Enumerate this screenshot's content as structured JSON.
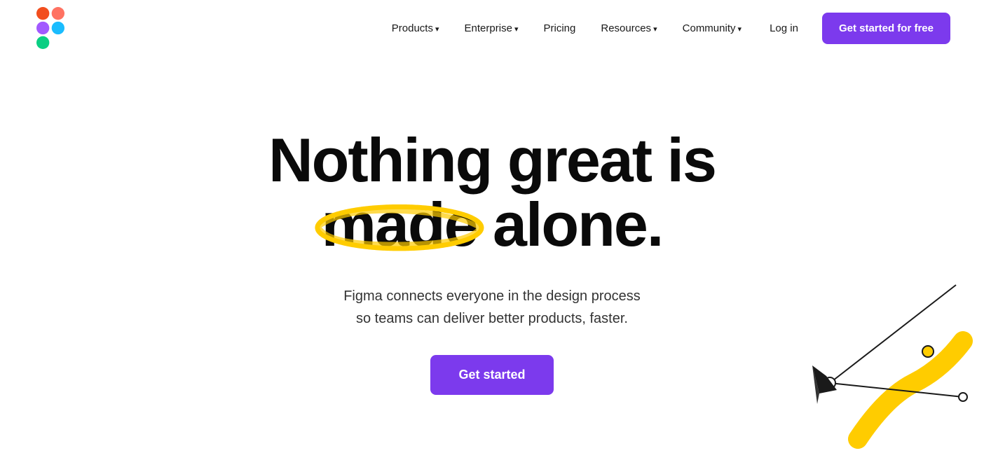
{
  "nav": {
    "logo_alt": "Figma logo",
    "links": [
      {
        "id": "products",
        "label": "Products",
        "has_arrow": true
      },
      {
        "id": "enterprise",
        "label": "Enterprise",
        "has_arrow": true
      },
      {
        "id": "pricing",
        "label": "Pricing",
        "has_arrow": false
      },
      {
        "id": "resources",
        "label": "Resources",
        "has_arrow": true
      },
      {
        "id": "community",
        "label": "Community",
        "has_arrow": true
      }
    ],
    "login_label": "Log in",
    "cta_label": "Get started for free"
  },
  "hero": {
    "title_line1": "Nothing great is",
    "title_line2_pre": "",
    "title_highlight": "made",
    "title_line2_post": " alone.",
    "subtitle_line1": "Figma connects everyone in the design process",
    "subtitle_line2": "so teams can deliver better products, faster.",
    "cta_label": "Get started"
  },
  "colors": {
    "cta_bg": "#7c3aed",
    "highlight_yellow": "#FFCC00"
  }
}
